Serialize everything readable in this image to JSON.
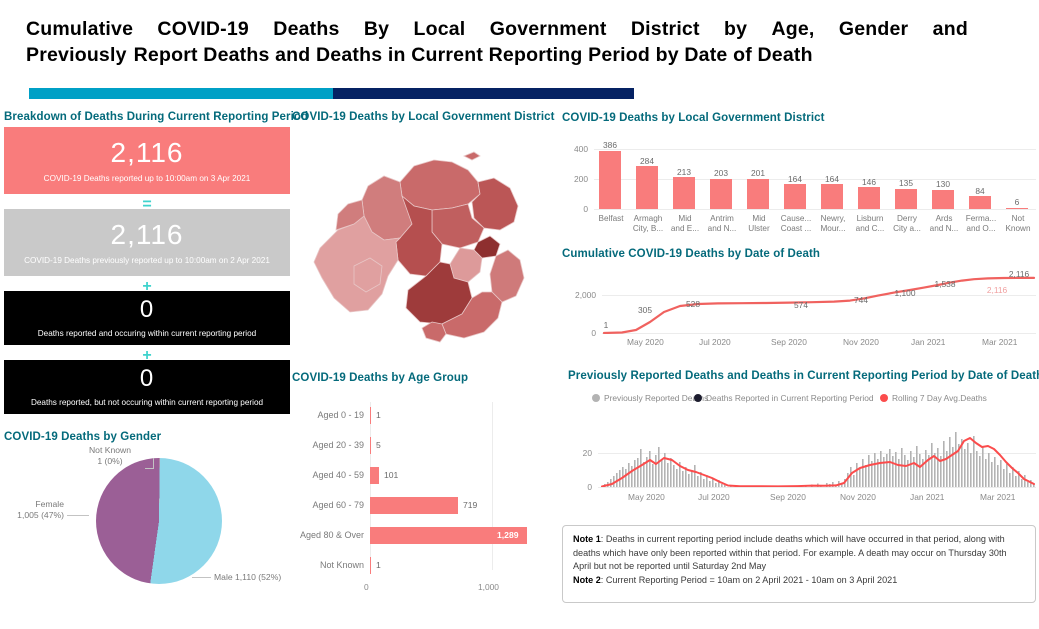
{
  "title": {
    "line1": [
      "Cumulative",
      "COVID-19",
      "Deaths",
      "By",
      "Local",
      "Government",
      "District",
      "by",
      "Age,",
      "Gender",
      "and"
    ],
    "line2": [
      "Previously",
      "Report Deaths and Deaths in Current Reporting Period by Date of Death"
    ],
    "accent_teal": "#00a0c6",
    "accent_navy": "#052263"
  },
  "breakdown": {
    "heading": "Breakdown of Deaths During Current Reporting Period",
    "cards": [
      {
        "value": "2,116",
        "caption": "COVID-19 Deaths reported up to 10:00am on 3 Apr 2021",
        "style": "red"
      },
      {
        "value": "2,116",
        "caption": "COVID-19 Deaths previously reported up to 10:00am on 2 Apr 2021",
        "style": "grey"
      },
      {
        "value": "0",
        "caption": "Deaths reported and occuring within current reporting period",
        "style": "black"
      },
      {
        "value": "0",
        "caption": "Deaths reported, but not occuring within current reporting period",
        "style": "black"
      }
    ],
    "operators": [
      "=",
      "+",
      "+"
    ]
  },
  "map_panel": {
    "heading": "COVID-19 Deaths by Local Government District"
  },
  "gender_chart": {
    "heading": "COVID-19 Deaths by Gender",
    "labels": {
      "not_known_l1": "Not Known",
      "not_known_l2": "1 (0%)",
      "female_l1": "Female",
      "female_l2": "1,005 (47%)",
      "male": "Male 1,110 (52%)"
    }
  },
  "notes": {
    "note1_label": "Note 1",
    "note1_text": ": Deaths in current reporting period include deaths which will have occurred in that period, along with deaths which have only been reported within that period. For example. A death may occur on Thursday 30th April but not be reported until Saturday 2nd May",
    "note2_label": "Note 2",
    "note2_text": ": Current Reporting Period = 10am on 2 April 2021 - 10am on 3 April 2021"
  },
  "chart_data": [
    {
      "type": "bar",
      "name": "deaths-by-district",
      "title": "COVID-19 Deaths by Local Government District",
      "categories": [
        "Belfast",
        "Armagh City, B...",
        "Mid and E...",
        "Antrim and N...",
        "Mid Ulster",
        "Cause... Coast ...",
        "Newry, Mour...",
        "Lisburn and C...",
        "Derry City a...",
        "Ards and N...",
        "Ferma... and O...",
        "Not Known"
      ],
      "category_lines": [
        [
          "Belfast",
          ""
        ],
        [
          "Armagh",
          "City, B..."
        ],
        [
          "Mid",
          "and E..."
        ],
        [
          "Antrim",
          "and N..."
        ],
        [
          "Mid",
          "Ulster"
        ],
        [
          "Cause...",
          "Coast ..."
        ],
        [
          "Newry,",
          "Mour..."
        ],
        [
          "Lisburn",
          "and C..."
        ],
        [
          "Derry",
          "City a..."
        ],
        [
          "Ards",
          "and N..."
        ],
        [
          "Ferma...",
          "and O..."
        ],
        [
          "Not",
          "Known"
        ]
      ],
      "values": [
        386,
        284,
        213,
        203,
        201,
        164,
        164,
        146,
        135,
        130,
        84,
        6
      ],
      "yticks": [
        "0",
        "200",
        "400"
      ],
      "ylim": [
        0,
        400
      ],
      "xlabel": "",
      "ylabel": "",
      "color": "#f97c7c"
    },
    {
      "type": "line",
      "name": "cumulative-deaths-by-date-of-death",
      "title": "Cumulative COVID-19 Deaths by Date of Death",
      "xlabel": "",
      "ylabel": "",
      "ylim": [
        0,
        2400
      ],
      "yticks": [
        "0",
        "2,000"
      ],
      "xticks": [
        "May 2020",
        "Jul 2020",
        "Sep 2020",
        "Nov 2020",
        "Jan 2021",
        "Mar 2021"
      ],
      "point_labels": [
        "1",
        "305",
        "528",
        "574",
        "744",
        "1,100",
        "1,538",
        "2,116",
        "2,116"
      ],
      "point_values": [
        1,
        305,
        528,
        574,
        744,
        1100,
        1538,
        2116,
        2116
      ],
      "color": "#f0625f"
    },
    {
      "type": "bar",
      "name": "previously-reported-and-current-period-deaths",
      "title": "Previously Reported Deaths and Deaths in Current Reporting Period by Date of Death",
      "legend": [
        {
          "label": "Previously Reported Deaths",
          "color": "#b3b3b3"
        },
        {
          "label": "Deaths Reported in Current Reporting Period",
          "color": "#1c1c2e"
        },
        {
          "label": "Rolling 7 Day Avg.Deaths",
          "color": "#fb4c4c"
        }
      ],
      "legend_position": "top",
      "yticks": [
        "0",
        "20"
      ],
      "ylim": [
        0,
        27
      ],
      "xticks": [
        "May 2020",
        "Jul 2020",
        "Sep 2020",
        "Nov 2020",
        "Jan 2021",
        "Mar 2021"
      ],
      "series": [
        {
          "name": "Previously Reported Deaths",
          "color": "#b3b3b3"
        },
        {
          "name": "Rolling 7 Day Avg.Deaths",
          "color": "#fb4c4c"
        }
      ]
    },
    {
      "type": "bar",
      "name": "deaths-by-age-group",
      "title": "COVID-19 Deaths by Age Group",
      "orientation": "horizontal",
      "categories": [
        "Aged 0 - 19",
        "Aged 20 - 39",
        "Aged 40 - 59",
        "Aged 60 - 79",
        "Aged 80 & Over",
        "Not Known"
      ],
      "values": [
        1,
        5,
        101,
        719,
        1289,
        1
      ],
      "value_labels": [
        "1",
        "5",
        "101",
        "719",
        "1,289",
        "1"
      ],
      "xticks": [
        "0",
        "1,000"
      ],
      "xlim": [
        0,
        1450
      ],
      "color": "#f97c7c"
    },
    {
      "type": "pie",
      "name": "deaths-by-gender",
      "title": "COVID-19 Deaths by Gender",
      "categories": [
        "Male",
        "Female",
        "Not Known"
      ],
      "values": [
        1110,
        1005,
        1
      ],
      "percentages": [
        "52%",
        "47%",
        "0%"
      ],
      "colors": [
        "#8fd7ea",
        "#9b5f96",
        "#bdbdbd"
      ]
    }
  ]
}
